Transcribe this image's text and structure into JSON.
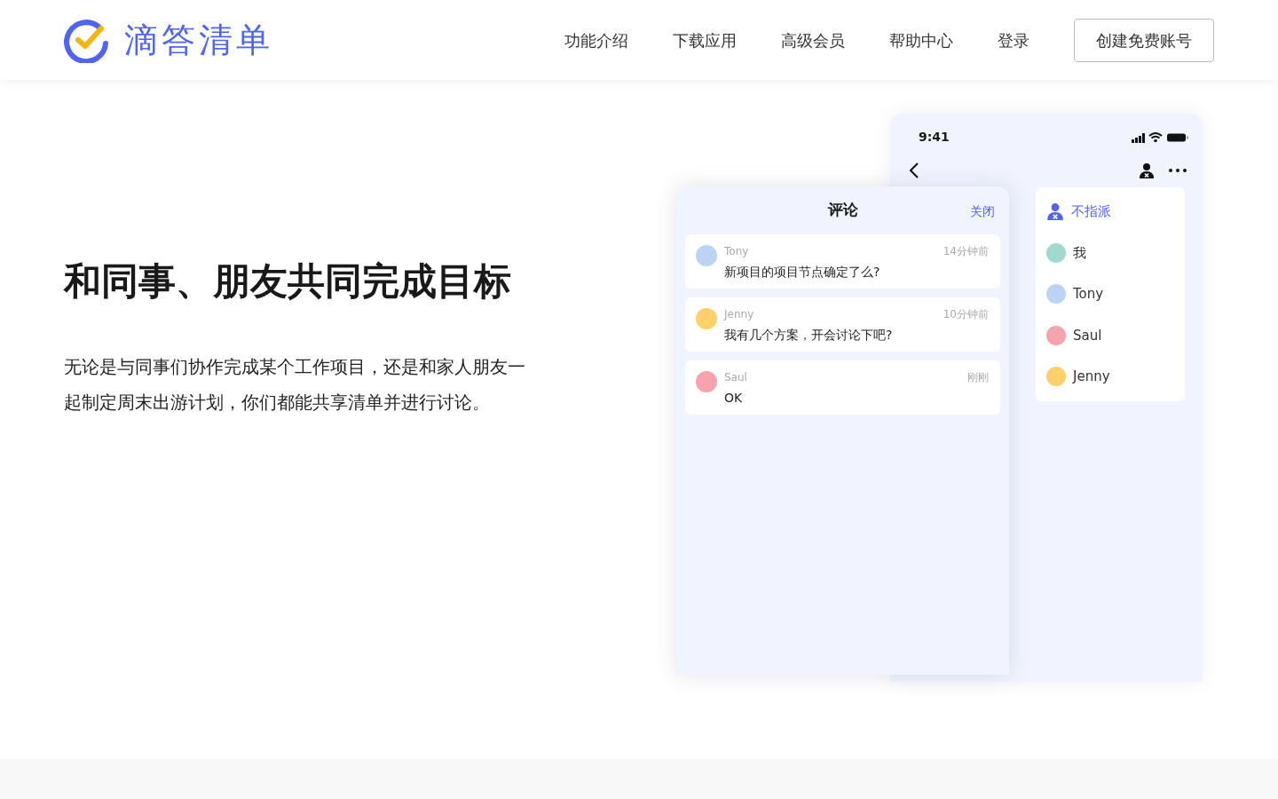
{
  "header": {
    "logo_text": "滴答清单",
    "nav": [
      "功能介绍",
      "下载应用",
      "高级会员",
      "帮助中心",
      "登录"
    ],
    "cta": "创建免费账号"
  },
  "hero": {
    "title": "和同事、朋友共同完成目标",
    "description": "无论是与同事们协作完成某个工作项目，还是和家人朋友一起制定周末出游计划，你们都能共享清单并进行讨论。"
  },
  "phone": {
    "time": "9:41",
    "assignees": [
      {
        "kind": "none",
        "label": "不指派",
        "selected": true
      },
      {
        "kind": "person",
        "label": "我",
        "selected": false,
        "color": "#9fd9cf"
      },
      {
        "kind": "person",
        "label": "Tony",
        "selected": false,
        "color": "#bcd3f5"
      },
      {
        "kind": "person",
        "label": "Saul",
        "selected": false,
        "color": "#f7a3ad"
      },
      {
        "kind": "person",
        "label": "Jenny",
        "selected": false,
        "color": "#fdd06a"
      }
    ]
  },
  "comments_panel": {
    "title": "评论",
    "close": "关闭",
    "comments": [
      {
        "author": "Tony",
        "time": "14分钟前",
        "text": "新项目的项目节点确定了么?",
        "color": "#bcd3f5"
      },
      {
        "author": "Jenny",
        "time": "10分钟前",
        "text": "我有几个方案，开会讨论下吧?",
        "color": "#fdd06a"
      },
      {
        "author": "Saul",
        "time": "刚刚",
        "text": "OK",
        "color": "#f7a3ad"
      }
    ]
  }
}
